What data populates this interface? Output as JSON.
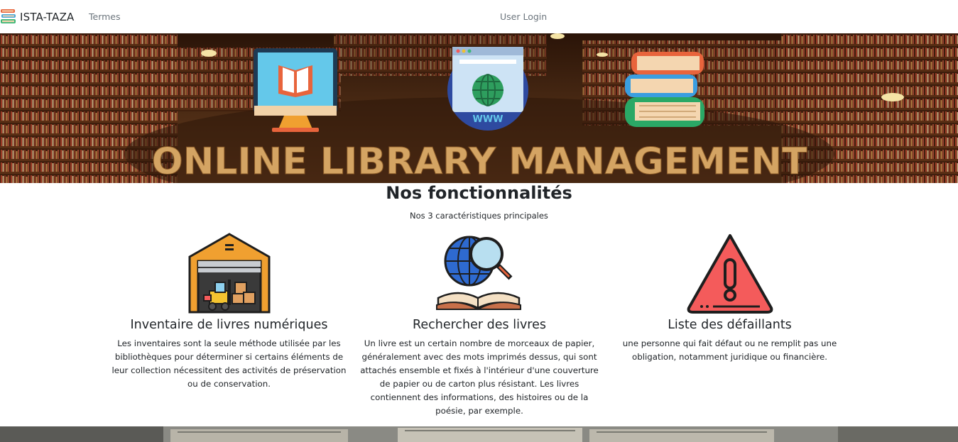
{
  "nav": {
    "brand": "ISTA-TAZA",
    "links": [
      {
        "label": "Termes"
      },
      {
        "label": "User Login"
      }
    ]
  },
  "hero": {
    "banner_text": "ONLINE LIBRARY MANAGEMENT",
    "www_label": "WWW"
  },
  "features": {
    "title": "Nos fonctionnalités",
    "subtitle": "Nos 3 caractéristiques principales",
    "items": [
      {
        "icon": "warehouse-icon",
        "title": "Inventaire de livres numériques",
        "text": "Les inventaires sont la seule méthode utilisée par les bibliothèques pour déterminer si certains éléments de leur collection nécessitent des activités de préservation ou de conservation."
      },
      {
        "icon": "book-search-icon",
        "title": "Rechercher des livres",
        "text": "Un livre est un certain nombre de morceaux de papier, généralement avec des mots imprimés dessus, qui sont attachés ensemble et fixés à l'intérieur d'une couverture de papier ou de carton plus résistant. Les livres contiennent des informations, des histoires ou de la poésie, par exemple."
      },
      {
        "icon": "warning-icon",
        "title": "Liste des défaillants",
        "text": "une personne qui fait défaut ou ne remplit pas une obligation, notamment juridique ou financière."
      }
    ]
  },
  "colors": {
    "banner_text": "#d4a463",
    "hero_bg": "#3a1f10",
    "warning_red": "#f45b5b",
    "warehouse_orange": "#f0a030"
  }
}
